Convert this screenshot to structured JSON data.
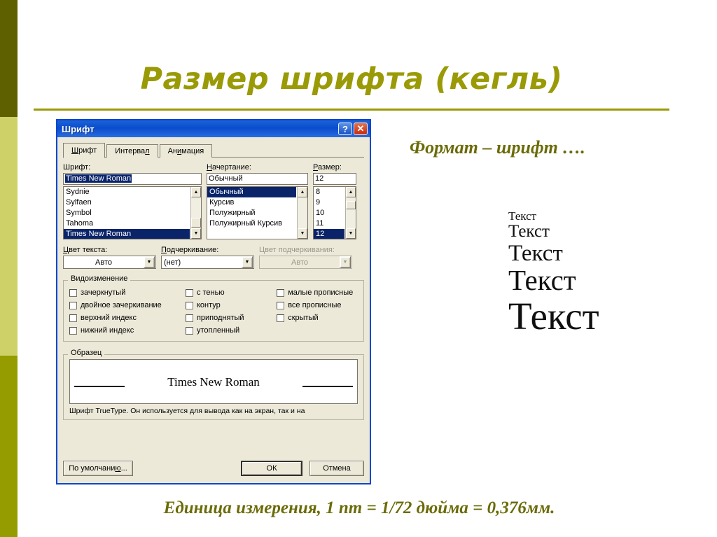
{
  "slide": {
    "title": "Размер шрифта (кегль)",
    "format_note": "Формат – шрифт ….",
    "bottom_caption": "Единица измерения, 1 пт = 1/72 дюйма = 0,376мм.",
    "accent_color": "#9a9a06",
    "note_color": "#6b6b08",
    "strip_colors": [
      "#5e6000",
      "#ced167",
      "#949c00"
    ],
    "text_samples": [
      "Текст",
      "Текст",
      "Текст",
      "Текст",
      "Текст"
    ]
  },
  "dialog": {
    "title": "Шрифт",
    "titlebar_color": "#0a4ccd",
    "help_button": "?",
    "close_button": "✕",
    "tabs": [
      {
        "label": "Шрифт",
        "active": true
      },
      {
        "label": "Интервал",
        "active": false
      },
      {
        "label": "Анимация",
        "active": false
      }
    ],
    "font": {
      "label": "Шрифт:",
      "value": "Times New Roman",
      "items": [
        "Sydnie",
        "Sylfaen",
        "Symbol",
        "Tahoma",
        "Times New Roman"
      ],
      "selected": "Times New Roman"
    },
    "style": {
      "label": "Начертание:",
      "value": "Обычный",
      "items": [
        "Обычный",
        "Курсив",
        "Полужирный",
        "Полужирный Курсив"
      ],
      "selected": "Обычный"
    },
    "size": {
      "label": "Размер:",
      "value": "12",
      "items": [
        "8",
        "9",
        "10",
        "11",
        "12"
      ],
      "selected": "12"
    },
    "color": {
      "label": "Цвет текста:",
      "value": "Авто"
    },
    "underline": {
      "label": "Подчеркивание:",
      "value": "(нет)"
    },
    "underline_color": {
      "label": "Цвет подчеркивания:",
      "value": "Авто",
      "disabled": true
    },
    "effects": {
      "title": "Видоизменение",
      "column1": [
        "зачеркнутый",
        "двойное зачеркивание",
        "верхний индекс",
        "нижний индекс"
      ],
      "column2": [
        "с тенью",
        "контур",
        "приподнятый",
        "утопленный"
      ],
      "column3": [
        "малые прописные",
        "все прописные",
        "скрытый"
      ]
    },
    "preview": {
      "title": "Образец",
      "text": "Times New Roman",
      "note": "Шрифт TrueType. Он используется для вывода как на экран, так и на"
    },
    "buttons": {
      "default": "По умолчанию...",
      "ok": "ОК",
      "cancel": "Отмена"
    }
  }
}
